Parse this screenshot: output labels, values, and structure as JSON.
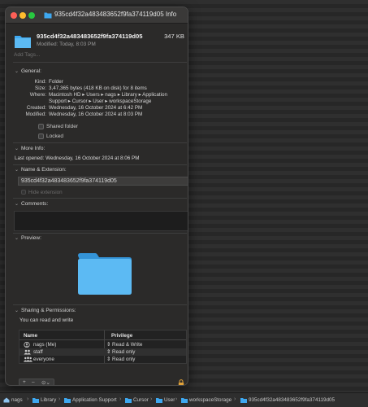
{
  "window": {
    "title": "935cd4f32a483483652f9fa374119d05 Info",
    "file_name": "935cd4f32a483483652f9fa374119d05",
    "file_size": "347 KB",
    "modified_short": "Modified: Today, 8:03 PM",
    "tags_placeholder": "Add Tags..."
  },
  "general": {
    "header": "General:",
    "kind_label": "Kind:",
    "kind": "Folder",
    "size_label": "Size:",
    "size": "3,47,365 bytes (418 KB on disk) for 8 items",
    "where_label": "Where:",
    "where_line1": "Macintosh HD ▸ Users ▸ nags ▸ Library ▸ Application",
    "where_line2": "Support ▸ Cursor ▸ User ▸ workspaceStorage",
    "created_label": "Created:",
    "created": "Wednesday, 16 October 2024 at 6:42 PM",
    "modified_label": "Modified:",
    "modified": "Wednesday, 16 October 2024 at 8:03 PM",
    "shared_folder": "Shared folder",
    "locked": "Locked"
  },
  "more_info": {
    "header": "More Info:",
    "last_opened": "Last opened: Wednesday, 16 October 2024 at 8:06 PM"
  },
  "name_ext": {
    "header": "Name & Extension:",
    "value": "935cd4f32a483483652f9fa374119d05",
    "hide_extension": "Hide extension"
  },
  "comments": {
    "header": "Comments:"
  },
  "preview": {
    "header": "Preview:"
  },
  "sharing": {
    "header": "Sharing & Permissions:",
    "summary": "You can read and write",
    "col_name": "Name",
    "col_privilege": "Privilege",
    "rows": [
      {
        "name": "nags (Me)",
        "privilege": "⇕ Read & Write"
      },
      {
        "name": "staff",
        "privilege": "⇕ Read only"
      },
      {
        "name": "everyone",
        "privilege": "⇕ Read only"
      }
    ],
    "add": "+",
    "remove": "–",
    "action": "⊙⌄"
  },
  "path_bar": [
    "nags",
    "Library",
    "Application Support",
    "Cursor",
    "User",
    "workspaceStorage",
    "935cd4f32a483483652f9fa374119d05"
  ],
  "path_separator": "›",
  "colors": {
    "folder": "#3ea8f0",
    "folder_tab": "#5cbaf3",
    "close": "#ff5f57",
    "minimize": "#febc2e",
    "zoom": "#28c840"
  }
}
